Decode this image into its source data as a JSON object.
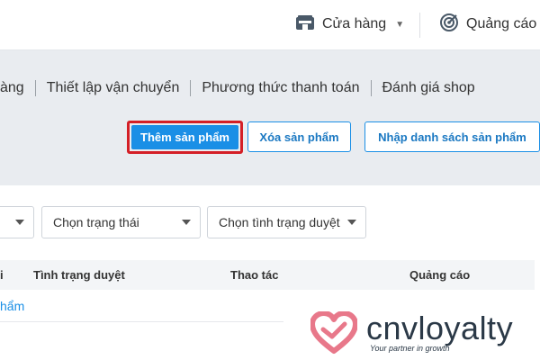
{
  "topbar": {
    "store_label": "Cửa hàng",
    "ads_label": "Quảng cáo"
  },
  "tabs": [
    {
      "label": "àng"
    },
    {
      "label": "Thiết lập vận chuyển"
    },
    {
      "label": "Phương thức thanh toán"
    },
    {
      "label": "Đánh giá shop"
    }
  ],
  "actions": {
    "add_label": "Thêm sản phẩm",
    "delete_label": "Xóa sản phẩm",
    "import_label": "Nhập danh sách sản phẩm"
  },
  "filters": [
    {
      "value": ""
    },
    {
      "value": "Chọn trạng thái"
    },
    {
      "value": "Chọn tình trạng duyệt"
    }
  ],
  "table": {
    "columns": [
      "i",
      "Tình trạng duyệt",
      "Thao tác",
      "Quảng cáo"
    ],
    "rows": [
      [
        "hẩm"
      ]
    ]
  },
  "watermark": {
    "brand": "cnvloyalty",
    "tagline": "Your partner in growth"
  },
  "colors": {
    "accent": "#1a8fe6",
    "highlight_border": "#d41f26",
    "band": "#e9ecf0",
    "brand_heart": "#e8788a"
  },
  "icons": {
    "store": "store-icon",
    "ads": "target-icon",
    "dropdown": "caret-down-icon",
    "logo": "heart-logo-icon"
  }
}
